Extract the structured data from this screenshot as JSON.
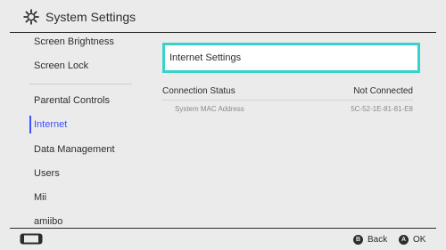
{
  "header": {
    "title": "System Settings",
    "icon": "gear-icon"
  },
  "sidebar": {
    "items": [
      {
        "label": "Screen Brightness"
      },
      {
        "label": "Screen Lock"
      },
      {
        "label": "Parental Controls"
      },
      {
        "label": "Internet"
      },
      {
        "label": "Data Management"
      },
      {
        "label": "Users"
      },
      {
        "label": "Mii"
      },
      {
        "label": "amiibo"
      }
    ],
    "selected": "Internet",
    "accent_color": "#3b50ff"
  },
  "main": {
    "focused_item": {
      "label": "Internet Settings",
      "focus_color": "#38d2cd"
    },
    "connection_status": {
      "label": "Connection Status",
      "value": "Not Connected"
    },
    "mac_address": {
      "label": "System MAC Address",
      "value": "5C-52-1E-81-81-E8"
    }
  },
  "footer": {
    "back": {
      "button": "B",
      "label": "Back"
    },
    "ok": {
      "button": "A",
      "label": "OK"
    }
  }
}
